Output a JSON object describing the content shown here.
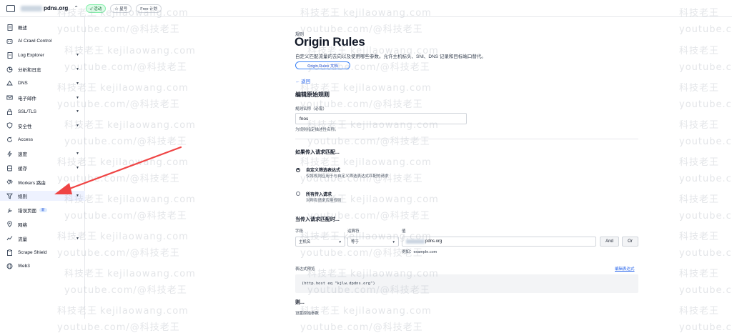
{
  "topbar": {
    "domain": "pdns.org",
    "status_badge": "✓ 活动",
    "star_badge": "☆ 星号",
    "plan_badge": "Free 计划"
  },
  "sidebar": {
    "items": [
      {
        "label": "概述",
        "icon": "document-icon"
      },
      {
        "label": "AI Crawl Control",
        "icon": "robot-icon"
      },
      {
        "label": "Log Explorer",
        "icon": "log-icon",
        "caret": true
      },
      {
        "label": "分析和日志",
        "icon": "chart-icon",
        "caret": true
      },
      {
        "label": "DNS",
        "icon": "dns-icon",
        "caret": true
      },
      {
        "label": "电子邮件",
        "icon": "mail-icon",
        "caret": true
      },
      {
        "label": "SSL/TLS",
        "icon": "lock-icon",
        "caret": true
      },
      {
        "label": "安全性",
        "icon": "shield-icon",
        "caret": true
      },
      {
        "label": "Access",
        "icon": "refresh-icon"
      },
      {
        "label": "速度",
        "icon": "lightning-icon",
        "caret": true
      },
      {
        "label": "缓存",
        "icon": "cache-icon",
        "caret": true
      },
      {
        "label": "Workers 路由",
        "icon": "workers-icon"
      },
      {
        "label": "规则",
        "icon": "funnel-icon",
        "caret": true,
        "active": true
      },
      {
        "label": "错误页面",
        "icon": "wrench-icon",
        "new": "新"
      },
      {
        "label": "网络",
        "icon": "pin-icon"
      },
      {
        "label": "流量",
        "icon": "traffic-icon",
        "caret": true
      },
      {
        "label": "Scrape Shield",
        "icon": "clipboard-icon"
      },
      {
        "label": "Web3",
        "icon": "web3-icon"
      }
    ]
  },
  "main": {
    "breadcrumb": "规则",
    "title": "Origin Rules",
    "description": "自定义匹配流量的去向以及使用哪些参数。允许主机标头、SNI、DNS 记录和目标端口替代。",
    "docs_button": "Origin Rules 文档",
    "back_link": "← 返回",
    "edit_heading": "编辑原始规则",
    "rule_name_label": "规则名称（必需）",
    "rule_name_value": "fnos",
    "rule_name_hint": "为规则指定描述性名称。",
    "if_heading": "如果传入请求匹配...",
    "radio_custom_title": "自定义筛选表达式",
    "radio_custom_sub": "仅将规则应用于与自定义筛选表达式匹配的请求",
    "radio_all_title": "所有传入请求",
    "radio_all_sub": "对所有请求应用规则",
    "when_heading": "当传入请求匹配时...",
    "field_label": "字段",
    "operator_label": "运算符",
    "value_label": "值",
    "field_value": "主机名",
    "operator_value": "等于",
    "value_text": "pdns.org",
    "and_button": "And",
    "or_button": "Or",
    "example": "例如：example.com",
    "expr_label": "表达式预览",
    "edit_expr_link": "编辑表达式",
    "expression": "(http.host eq \"kjlw.dpdns.org\")",
    "then_heading": "则...",
    "then_sub": "设置原始参数"
  },
  "watermark": {
    "cn": "科技老王",
    "en": "kejilaowang.com",
    "url": "youtube.com/@科技老王"
  },
  "colors": {
    "accent": "#2563eb",
    "arrow": "#ef4444",
    "active_bg": "#eef2ff"
  }
}
